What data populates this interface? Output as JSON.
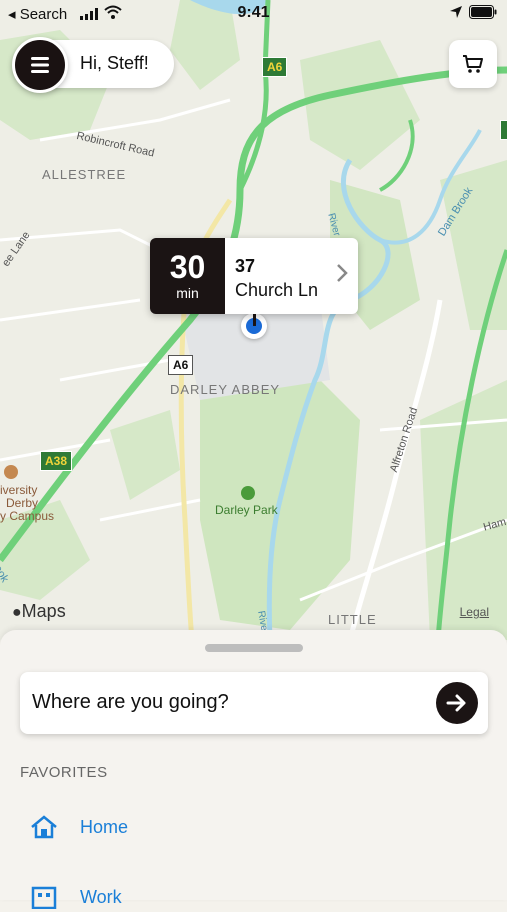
{
  "status_bar": {
    "back_label": "◂ Search",
    "time": "9:41"
  },
  "header": {
    "greeting": "Hi, Steff!"
  },
  "map": {
    "places": {
      "allestree": "ALLESTREE",
      "darley_abbey": "DARLEY ABBEY",
      "little": "LITTLE",
      "darley_park": "Darley Park",
      "university_1": "iversity",
      "university_2": "Derby",
      "university_3": "y Campus"
    },
    "roads": {
      "robincroft": "Robincroft Road",
      "alfreton": "Alfreton Road",
      "dam_brook": "Dam Brook",
      "lane": "ee Lane",
      "river": "River",
      "river_2": "Rive",
      "ham": "Ham",
      "rook": "rook"
    },
    "shields": {
      "a6_top": "A6",
      "a6_mid": "A6",
      "a38": "A38"
    },
    "attribution": "Maps",
    "legal": "Legal"
  },
  "eta_card": {
    "minutes": "30",
    "unit": "min",
    "address_line1": "37",
    "address_line2": "Church Ln"
  },
  "sheet": {
    "search_prompt": "Where are you going?",
    "favorites_header": "FAVORITES",
    "favorites": [
      {
        "label": "Home",
        "icon": "house-icon"
      },
      {
        "label": "Work",
        "icon": "building-icon"
      }
    ]
  },
  "colors": {
    "accent": "#1a7fd8",
    "dark": "#1b1414",
    "road_green": "#6fd07a",
    "water": "#a8d8ec",
    "park": "#cfe6bf"
  }
}
